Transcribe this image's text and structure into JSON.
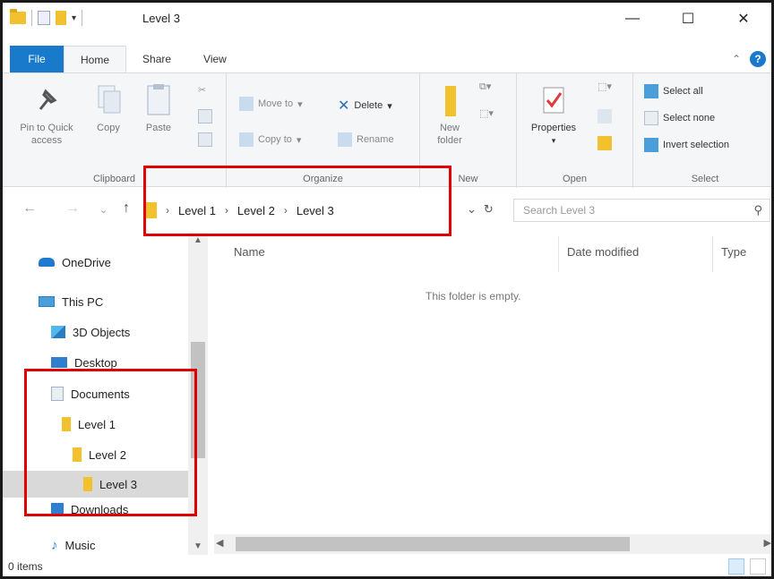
{
  "window": {
    "title": "Level 3"
  },
  "title_controls": {
    "minimize": "—",
    "maximize": "☐",
    "close": "✕"
  },
  "tabs": [
    {
      "label": "File"
    },
    {
      "label": "Home"
    },
    {
      "label": "Share"
    },
    {
      "label": "View"
    }
  ],
  "ribbon": {
    "clipboard": {
      "label": "Clipboard",
      "pin_label": "Pin to Quick access",
      "copy_label": "Copy",
      "paste_label": "Paste"
    },
    "organize": {
      "label": "Organize",
      "move_to": "Move to",
      "copy_to": "Copy to",
      "delete": "Delete",
      "rename": "Rename"
    },
    "new": {
      "label": "New",
      "new_folder": "New folder"
    },
    "open": {
      "label": "Open",
      "properties": "Properties"
    },
    "select": {
      "label": "Select",
      "select_all": "Select all",
      "select_none": "Select none",
      "invert_selection": "Invert selection"
    }
  },
  "address": {
    "crumbs": [
      "Level 1",
      "Level 2",
      "Level 3"
    ],
    "search_placeholder": "Search Level 3"
  },
  "sidebar": {
    "items": [
      {
        "label": "OneDrive"
      },
      {
        "label": "This PC"
      },
      {
        "label": "3D Objects"
      },
      {
        "label": "Desktop"
      },
      {
        "label": "Documents"
      },
      {
        "label": "Level 1"
      },
      {
        "label": "Level 2"
      },
      {
        "label": "Level 3"
      },
      {
        "label": "Downloads"
      },
      {
        "label": "Music"
      }
    ]
  },
  "content": {
    "columns": [
      "Name",
      "Date modified",
      "Type"
    ],
    "empty_message": "This folder is empty."
  },
  "status": {
    "items": "0 items"
  },
  "colors": {
    "accent": "#1979ca",
    "highlight": "#e00000",
    "folder": "#f2c22e"
  }
}
